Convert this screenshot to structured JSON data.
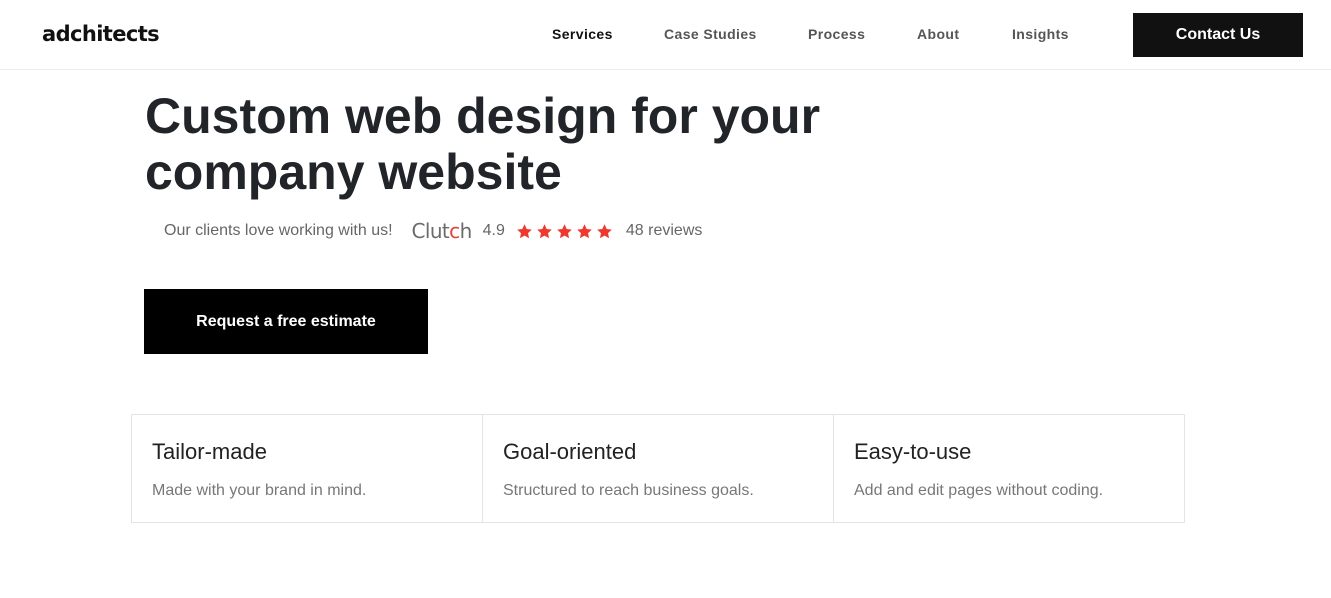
{
  "header": {
    "logo": "adchitects",
    "nav": [
      {
        "label": "Services",
        "active": true
      },
      {
        "label": "Case Studies",
        "active": false
      },
      {
        "label": "Process",
        "active": false
      },
      {
        "label": "About",
        "active": false
      },
      {
        "label": "Insights",
        "active": false
      }
    ],
    "contact_label": "Contact Us"
  },
  "hero": {
    "title_line1": "Custom web design for your",
    "title_line2": "company website",
    "rating": {
      "lead": "Our clients love working with us!",
      "brand_main": "Clut",
      "brand_accent": "c",
      "brand_end": "h",
      "score": "4.9",
      "stars": 5,
      "star_color": "#ee3a2e",
      "reviews": "48 reviews"
    },
    "cta_label": "Request a free estimate"
  },
  "features": [
    {
      "title": "Tailor-made",
      "desc": "Made with your brand in mind."
    },
    {
      "title": "Goal-oriented",
      "desc": "Structured to reach business goals."
    },
    {
      "title": "Easy-to-use",
      "desc": "Add and edit pages without coding."
    }
  ]
}
